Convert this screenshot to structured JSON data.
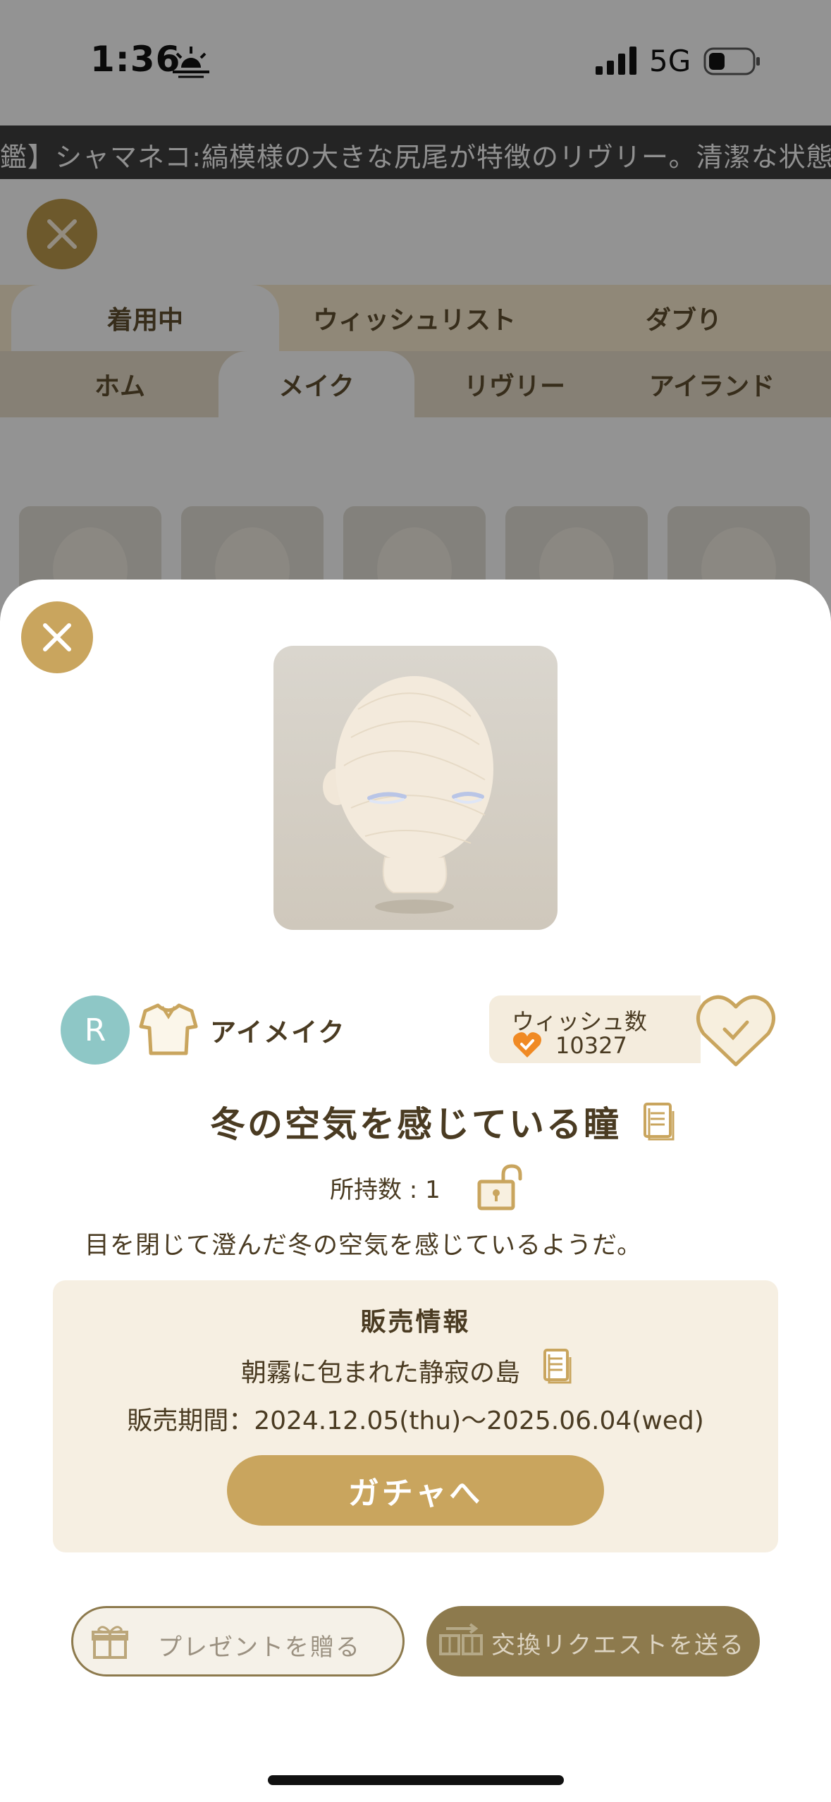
{
  "status_bar": {
    "time": "1:36",
    "network": "5G"
  },
  "ticker": {
    "text": "鑑】シャマネコ:縞模様の大きな尻尾が特徴のリヴリー。清潔な状態を"
  },
  "tabs_row1": [
    "着用中",
    "ウィッシュリスト",
    "ダブり"
  ],
  "tabs_row2": [
    "ホム",
    "メイク",
    "リヴリー",
    "アイランド"
  ],
  "item": {
    "rarity": "R",
    "category": "アイメイク",
    "wish_label": "ウィッシュ数",
    "wish_count": "10327",
    "title": "冬の空気を感じている瞳",
    "owned": "所持数 : 1",
    "description": "目を閉じて澄んだ冬の空気を感じているようだ。"
  },
  "sales": {
    "heading": "販売情報",
    "source": "朝霧に包まれた静寂の島",
    "period": "販売期間：2024.12.05(thu)〜2025.06.04(wed)",
    "button": "ガチャへ"
  },
  "actions": {
    "gift": "プレゼントを贈る",
    "trade": "交換リクエストを送る"
  },
  "colors": {
    "accent": "#c9a55e",
    "text": "#4a3b22",
    "panel": "#f6efe2"
  }
}
